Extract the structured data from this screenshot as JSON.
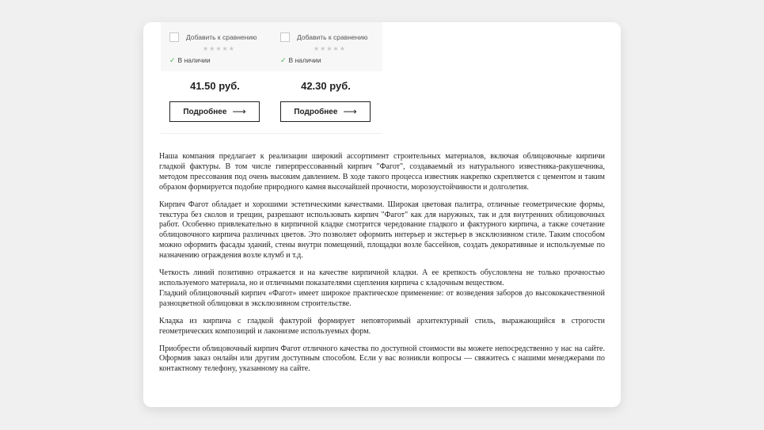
{
  "products": [
    {
      "compare_label": "Добавить к сравнению",
      "stars": "★★★★★",
      "stock_label": "В наличии",
      "price": "41.50 руб.",
      "button_label": "Подробнее"
    },
    {
      "compare_label": "Добавить к сравнению",
      "stars": "★★★★★",
      "stock_label": "В наличии",
      "price": "42.30 руб.",
      "button_label": "Подробнее"
    }
  ],
  "icons": {
    "arrow": "long-arrow-right-icon",
    "check": "check-icon",
    "star": "star-icon"
  },
  "colors": {
    "background": "#f0f0f0",
    "card": "#ffffff",
    "stock_check": "#4caf50",
    "text": "#222222"
  },
  "article": {
    "p1": "Наша компания предлагает к реализации широкий ассортимент строительных материалов, включая облицовочные кирпичи гладкой фактуры. В том числе гиперпрессованный кирпич \"Фагот\", создаваемый из натурального известняка-ракушечника, методом прессования под очень высоким давлением. В ходе такого процесса известняк накрепко скрепляется с цементом и таким образом формируется подобие природного камня высочайшей прочности, морозоустойчивости и долголетия.",
    "p2": "Кирпич Фагот обладает и хорошими эстетическими качествами. Широкая цветовая палитра, отличные геометрические формы, текстура без сколов и трещин, разрешают использовать кирпич \"Фагот\" как для наружных, так и для внутренних облицовочных работ. Особенно привлекательно в кирпичной кладке смотрится чередование гладкого и фактурного кирпича, а также сочетание облицовочного кирпича различных цветов. Это позволяет оформить интерьер и экстерьер в эксклюзивном стиле. Таким способом можно оформить фасады зданий, стены внутри помещений, площадки возле бассейнов, создать декоративные и используемые по назначению ограждения возле клумб и т.д.",
    "p3": "Четкость линий позитивно отражается и на качестве кирпичной кладки. А ее крепкость обусловлена не только прочностью используемого материала, но и отличными показателями сцепления кирпича с кладочным веществом.",
    "p4": "Гладкий облицовочный кирпич «Фагот» имеет широкое практическое применение: от возведения заборов до высококачественной разноцветной облицовки в эксклюзивном строительстве.",
    "p5": "Кладка из кирпича с гладкой фактурой формирует неповторимый архитектурный стиль, выражающийся в строгости геометрических композиций и лаконизме используемых форм.",
    "p6": "Приобрести облицовочный кирпич Фагот отличного качества по доступной стоимости вы можете непосредственно у нас на сайте. Оформив заказ онлайн или другим доступным способом. Если у вас возникли вопросы — свяжитесь с нашими менеджерами по контактному телефону, указанному на сайте."
  }
}
